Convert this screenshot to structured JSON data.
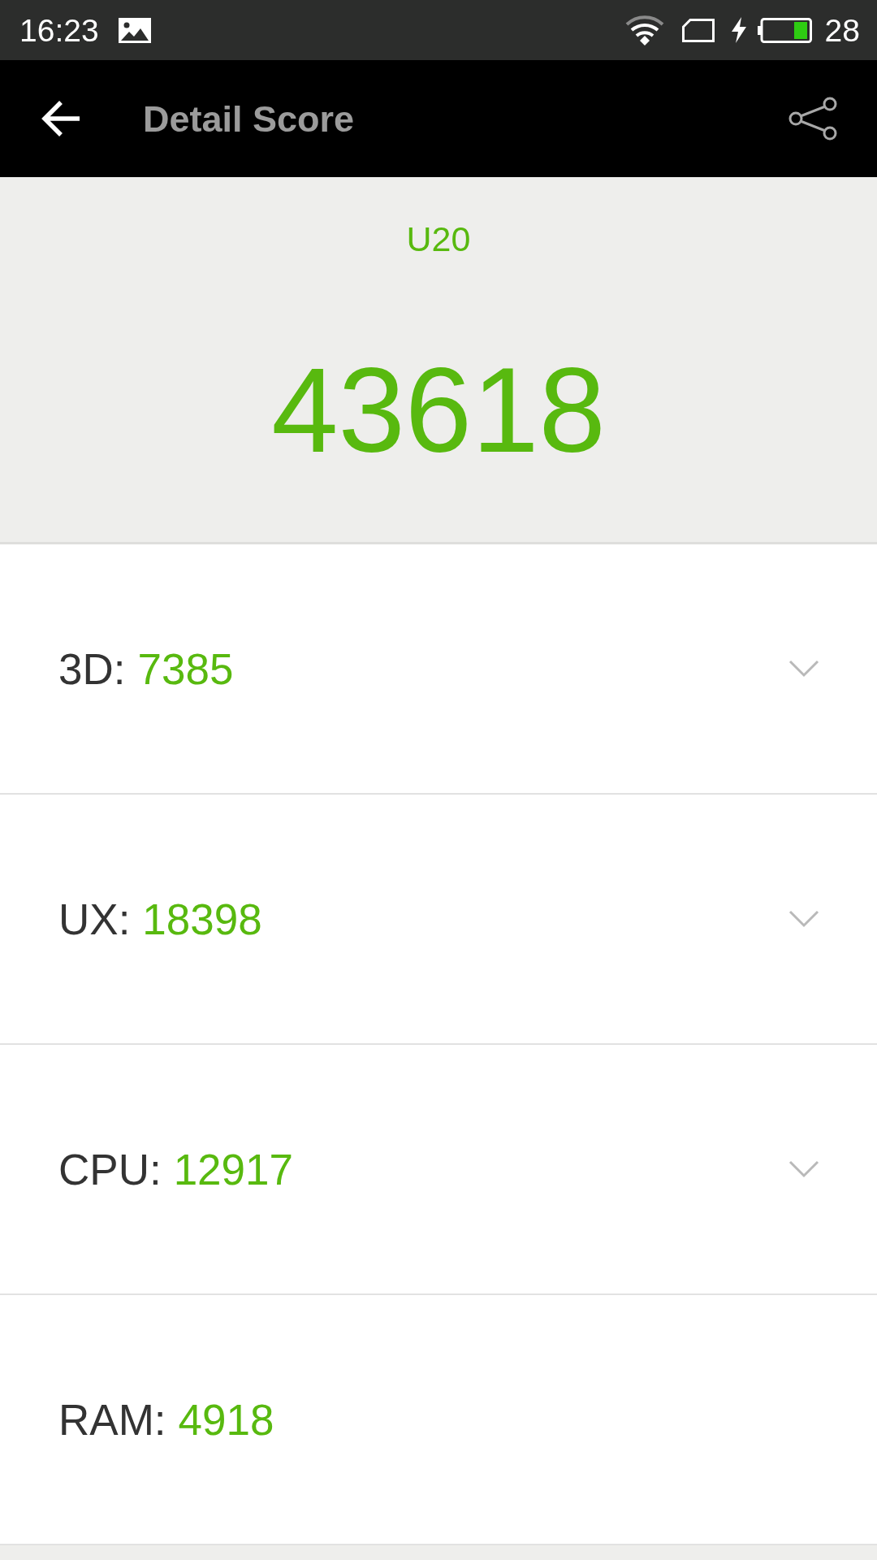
{
  "status_bar": {
    "time": "16:23",
    "battery": "28"
  },
  "app_bar": {
    "title": "Detail Score"
  },
  "summary": {
    "device": "U20",
    "total_score": "43618"
  },
  "scores": [
    {
      "label": "3D:",
      "value": "7385",
      "kind": "expandable"
    },
    {
      "label": "UX:",
      "value": "18398",
      "kind": "expandable"
    },
    {
      "label": "CPU:",
      "value": "12917",
      "kind": "expandable"
    },
    {
      "label": "RAM:",
      "value": "4918",
      "kind": "plain"
    }
  ]
}
